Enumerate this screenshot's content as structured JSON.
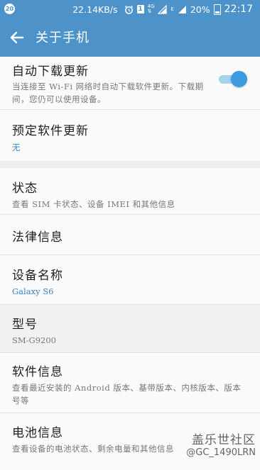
{
  "status_bar": {
    "notification_count": "20",
    "net_speed": "22.14KB/s",
    "sim_label": "1",
    "network_type": "4G",
    "signal_label": "E",
    "battery_percent": "20%",
    "time": "22:17"
  },
  "header": {
    "title": "关于手机"
  },
  "settings": {
    "auto_update": {
      "title": "自动下载更新",
      "subtitle": "当连接至 Wi-Fi 网络时自动下载软件更新。下载期间，您仍可以使用设备。",
      "enabled": true
    },
    "scheduled_update": {
      "title": "预定软件更新",
      "value": "无"
    },
    "status": {
      "title": "状态",
      "subtitle": "查看 SIM 卡状态、设备 IMEI 和其他信息"
    },
    "legal": {
      "title": "法律信息"
    },
    "device_name": {
      "title": "设备名称",
      "value": "Galaxy S6"
    },
    "model": {
      "title": "型号",
      "value": "SM-G9200"
    },
    "software_info": {
      "title": "软件信息",
      "subtitle": "查看最近安装的 Android 版本、基带版本、内核版本、版本号等"
    },
    "battery_info": {
      "title": "电池信息",
      "subtitle": "查看设备的电池状态、剩余电量和其他信息"
    }
  },
  "watermark": {
    "line1": "盖乐世社区",
    "line2": "@GC_1490LRN"
  },
  "colors": {
    "accent": "#4d93c9",
    "toggle": "#3d9be0",
    "value_blue": "#3a84c2"
  }
}
